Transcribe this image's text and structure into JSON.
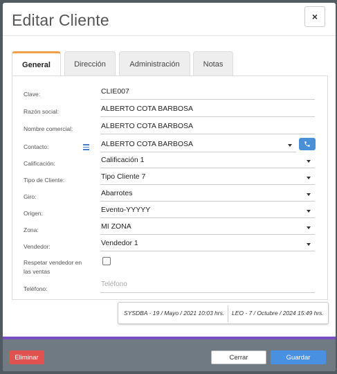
{
  "modal": {
    "title": "Editar Cliente",
    "close_label": "×"
  },
  "tabs": [
    {
      "label": "General",
      "active": true
    },
    {
      "label": "Dirección",
      "active": false
    },
    {
      "label": "Administración",
      "active": false
    },
    {
      "label": "Notas",
      "active": false
    }
  ],
  "form": {
    "clave": {
      "label": "Clave:",
      "value": "CLIE007"
    },
    "razon_social": {
      "label": "Razón social:",
      "value": "ALBERTO COTA BARBOSA"
    },
    "nombre_comercial": {
      "label": "Nombre comercial:",
      "value": "ALBERTO COTA BARBOSA"
    },
    "contacto": {
      "label": "Contacto:",
      "value": "ALBERTO COTA BARBOSA"
    },
    "calificacion": {
      "label": "Calificación:",
      "value": "Calificación 1"
    },
    "tipo_cliente": {
      "label": "Tipo de Cliente:",
      "value": "Tipo Cliente 7"
    },
    "giro": {
      "label": "Giro:",
      "value": "Abarrotes"
    },
    "origen": {
      "label": "Origen:",
      "value": "Evento-YYYYY"
    },
    "zona": {
      "label": "Zona:",
      "value": "MI ZONA"
    },
    "vendedor": {
      "label": "Vendedor:",
      "value": "Vendedor 1"
    },
    "respetar_vendedor": {
      "label_line1": "Respetar vendedor en",
      "label_line2": "las ventas",
      "checked": false
    },
    "telefono": {
      "label": "Teléfono:",
      "placeholder": "Teléfono"
    }
  },
  "audit": {
    "created": "SYSDBA - 19 / Mayo / 2021 10:03 hrs.",
    "modified": "LEO - 7 / Octubre / 2024 15:49 hrs."
  },
  "footer": {
    "delete_label": "Eliminar",
    "close_label": "Cerrar",
    "save_label": "Guardar"
  },
  "colors": {
    "tab_accent": "#f0a04a",
    "primary": "#4a90e2",
    "danger": "#e05252",
    "footer_accent": "#7a4fc0"
  }
}
